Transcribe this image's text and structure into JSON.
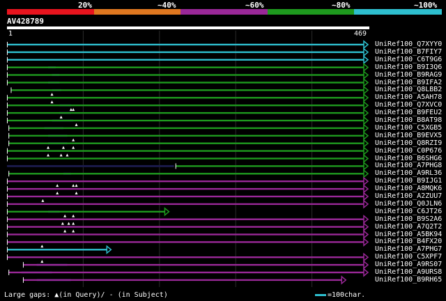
{
  "legend": {
    "labels": [
      "20%",
      "~40%",
      "~60%",
      "~80%",
      "~100%"
    ],
    "colors": [
      "#e8141e",
      "#e07820",
      "#9a2898",
      "#1e9a1e",
      "#2ebfcf"
    ]
  },
  "query": {
    "id": "AV428789",
    "ruler_start": "1",
    "ruler_end": "469",
    "length": 469
  },
  "hits": [
    {
      "name": "UniRef100_Q7XYY0",
      "color": "cyan",
      "segs": [
        [
          1,
          469
        ]
      ],
      "arrow": true,
      "q": [],
      "s": []
    },
    {
      "name": "UniRef100_B7FIY7",
      "color": "cyan",
      "segs": [
        [
          1,
          469
        ]
      ],
      "arrow": true,
      "q": [],
      "s": []
    },
    {
      "name": "UniRef100_C6T9G6",
      "color": "cyan",
      "segs": [
        [
          1,
          469
        ]
      ],
      "arrow": true,
      "q": [],
      "s": []
    },
    {
      "name": "UniRef100_B9I3Q6",
      "color": "green",
      "segs": [
        [
          1,
          469
        ]
      ],
      "arrow": true,
      "q": [],
      "s": [
        55,
        65
      ]
    },
    {
      "name": "UniRef100_B9RAG9",
      "color": "green",
      "segs": [
        [
          1,
          469
        ]
      ],
      "arrow": true,
      "q": [],
      "s": [
        60,
        70
      ]
    },
    {
      "name": "UniRef100_B9IFA2",
      "color": "green",
      "segs": [
        [
          1,
          469
        ]
      ],
      "arrow": true,
      "q": [],
      "s": [
        55,
        70
      ]
    },
    {
      "name": "UniRef100_Q8LBB2",
      "color": "green",
      "segs": [
        [
          6,
          469
        ]
      ],
      "arrow": true,
      "q": [],
      "s": [
        60,
        72
      ]
    },
    {
      "name": "UniRef100_A5AH78",
      "color": "green",
      "segs": [
        [
          1,
          469
        ]
      ],
      "arrow": true,
      "q": [
        60
      ],
      "s": []
    },
    {
      "name": "UniRef100_Q7XVC0",
      "color": "green",
      "segs": [
        [
          1,
          469
        ]
      ],
      "arrow": true,
      "q": [
        60
      ],
      "s": [
        70,
        85
      ]
    },
    {
      "name": "UniRef100_B9FEU2",
      "color": "green",
      "segs": [
        [
          1,
          469
        ]
      ],
      "arrow": true,
      "q": [
        85,
        88
      ],
      "s": [
        70,
        85
      ]
    },
    {
      "name": "UniRef100_B8AT98",
      "color": "green",
      "segs": [
        [
          1,
          469
        ]
      ],
      "arrow": true,
      "q": [
        72
      ],
      "s": [
        60,
        88
      ]
    },
    {
      "name": "UniRef100_C5XGB5",
      "color": "green",
      "segs": [
        [
          3,
          469
        ]
      ],
      "arrow": true,
      "q": [
        92
      ],
      "s": [
        50,
        75
      ]
    },
    {
      "name": "UniRef100_B9EVX5",
      "color": "green",
      "segs": [
        [
          3,
          469
        ]
      ],
      "arrow": true,
      "q": [],
      "s": [
        55,
        80
      ]
    },
    {
      "name": "UniRef100_Q8RZI9",
      "color": "green",
      "segs": [
        [
          3,
          469
        ]
      ],
      "arrow": true,
      "q": [
        88
      ],
      "s": [
        55,
        80
      ]
    },
    {
      "name": "UniRef100_C0P676",
      "color": "green",
      "segs": [
        [
          1,
          469
        ]
      ],
      "arrow": true,
      "q": [
        55,
        75,
        88
      ],
      "s": []
    },
    {
      "name": "UniRef100_B6SHG6",
      "color": "green",
      "segs": [
        [
          1,
          469
        ]
      ],
      "arrow": true,
      "q": [
        55,
        72,
        80
      ],
      "s": []
    },
    {
      "name": "UniRef100_A7PHG8",
      "color": "green",
      "segs": [
        [
          222,
          469
        ]
      ],
      "arrow": true,
      "q": [],
      "s": [
        1,
        220
      ]
    },
    {
      "name": "UniRef100_A9RL36",
      "color": "green",
      "segs": [
        [
          3,
          469
        ]
      ],
      "arrow": true,
      "q": [],
      "s": [
        75,
        85
      ]
    },
    {
      "name": "UniRef100_B9IJG1",
      "color": "purple",
      "segs": [
        [
          1,
          469
        ]
      ],
      "arrow": true,
      "q": [],
      "s": []
    },
    {
      "name": "UniRef100_A8MQK6",
      "color": "purple",
      "segs": [
        [
          1,
          469
        ]
      ],
      "arrow": true,
      "q": [
        67,
        88,
        92
      ],
      "s": []
    },
    {
      "name": "UniRef100_A2ZUU7",
      "color": "purple",
      "segs": [
        [
          1,
          469
        ]
      ],
      "arrow": true,
      "q": [
        67,
        92
      ],
      "s": []
    },
    {
      "name": "UniRef100_Q0JLN6",
      "color": "purple",
      "segs": [
        [
          1,
          469
        ]
      ],
      "arrow": true,
      "q": [
        48
      ],
      "s": []
    },
    {
      "name": "UniRef100_C6JT26",
      "color": "green",
      "segs": [
        [
          1,
          208
        ]
      ],
      "arrow": true,
      "q": [],
      "s": [
        55,
        70
      ]
    },
    {
      "name": "UniRef100_B9S2A6",
      "color": "purple",
      "segs": [
        [
          1,
          469
        ]
      ],
      "arrow": true,
      "q": [
        77,
        88
      ],
      "s": []
    },
    {
      "name": "UniRef100_A7Q2T2",
      "color": "purple",
      "segs": [
        [
          1,
          469
        ]
      ],
      "arrow": true,
      "q": [
        74,
        82,
        88
      ],
      "s": []
    },
    {
      "name": "UniRef100_A5BK94",
      "color": "purple",
      "segs": [
        [
          1,
          469
        ]
      ],
      "arrow": true,
      "q": [
        77,
        88
      ],
      "s": []
    },
    {
      "name": "UniRef100_B4FX20",
      "color": "purple",
      "segs": [
        [
          1,
          469
        ]
      ],
      "arrow": true,
      "q": [],
      "s": []
    },
    {
      "name": "UniRef100_A7PHG7",
      "color": "cyan",
      "segs": [
        [
          1,
          132
        ]
      ],
      "arrow": true,
      "q": [
        47
      ],
      "s": []
    },
    {
      "name": "UniRef100_C5XPF7",
      "color": "purple",
      "segs": [
        [
          1,
          469
        ]
      ],
      "arrow": true,
      "q": [],
      "s": []
    },
    {
      "name": "UniRef100_A9RS07",
      "color": "purple",
      "segs": [
        [
          22,
          469
        ]
      ],
      "arrow": true,
      "q": [
        47
      ],
      "s": [
        40,
        80
      ]
    },
    {
      "name": "UniRef100_A9URS8",
      "color": "purple",
      "segs": [
        [
          3,
          469
        ]
      ],
      "arrow": true,
      "q": [],
      "s": [
        20,
        60
      ]
    },
    {
      "name": "UniRef100_B9RH65",
      "color": "purple",
      "segs": [
        [
          22,
          440
        ]
      ],
      "arrow": true,
      "q": [],
      "s": [
        40,
        85
      ]
    }
  ],
  "footer": {
    "large_gaps": "Large gaps:",
    "in_query": "(in Query)/",
    "in_subject": "- (in Subject)",
    "scale_label": "=100char."
  }
}
